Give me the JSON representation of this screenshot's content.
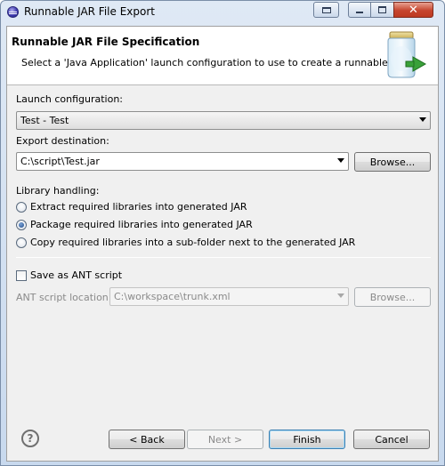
{
  "window": {
    "title": "Runnable JAR File Export",
    "controls": {
      "close_glyph": "✕"
    }
  },
  "header": {
    "title": "Runnable JAR File Specification",
    "description": "Select a 'Java Application' launch configuration to use to create a runnable JAR."
  },
  "launch": {
    "label": "Launch configuration:",
    "value": "Test - Test"
  },
  "export": {
    "label": "Export destination:",
    "value": "C:\\script\\Test.jar",
    "browse_label": "Browse..."
  },
  "library": {
    "label": "Library handling:",
    "options": [
      {
        "label": "Extract required libraries into generated JAR",
        "checked": false
      },
      {
        "label": "Package required libraries into generated JAR",
        "checked": true
      },
      {
        "label": "Copy required libraries into a sub-folder next to the generated JAR",
        "checked": false
      }
    ]
  },
  "ant": {
    "checkbox_label": "Save as ANT script",
    "checked": false,
    "location_label": "ANT script location:",
    "location_value": "C:\\workspace\\trunk.xml",
    "browse_label": "Browse..."
  },
  "footer": {
    "help_glyph": "?",
    "back_label": "< Back",
    "next_label": "Next >",
    "finish_label": "Finish",
    "cancel_label": "Cancel"
  }
}
